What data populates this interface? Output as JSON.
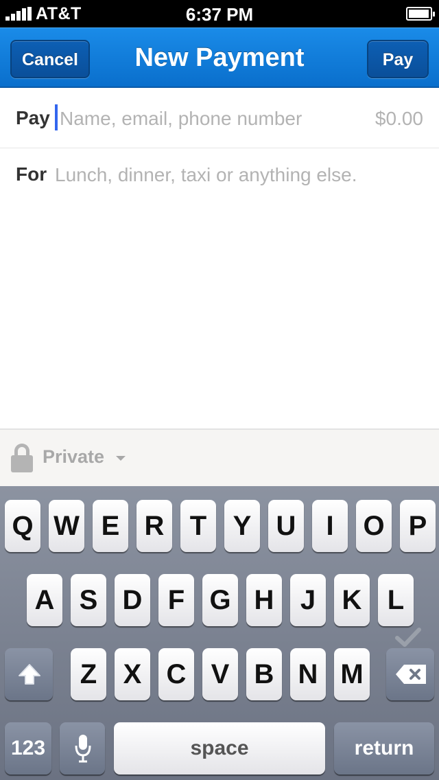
{
  "status_bar": {
    "carrier": "AT&T",
    "time": "6:37 PM",
    "signal_icon": "signal-bars-icon",
    "battery_icon": "battery-icon"
  },
  "nav": {
    "title": "New Payment",
    "cancel_label": "Cancel",
    "pay_label": "Pay",
    "color": "#0a6fcc"
  },
  "form": {
    "pay_label": "Pay",
    "recipient_placeholder": "Name, email, phone number",
    "amount": "$0.00",
    "for_label": "For",
    "note_placeholder": "Lunch, dinner, taxi or anything else."
  },
  "privacy": {
    "icon": "lock-icon",
    "label": "Private"
  },
  "keyboard": {
    "row1": [
      "Q",
      "W",
      "E",
      "R",
      "T",
      "Y",
      "U",
      "I",
      "O",
      "P"
    ],
    "row2": [
      "A",
      "S",
      "D",
      "F",
      "G",
      "H",
      "J",
      "K",
      "L"
    ],
    "row3": [
      "Z",
      "X",
      "C",
      "V",
      "B",
      "N",
      "M"
    ],
    "numbers_label": "123",
    "space_label": "space",
    "return_label": "return"
  }
}
